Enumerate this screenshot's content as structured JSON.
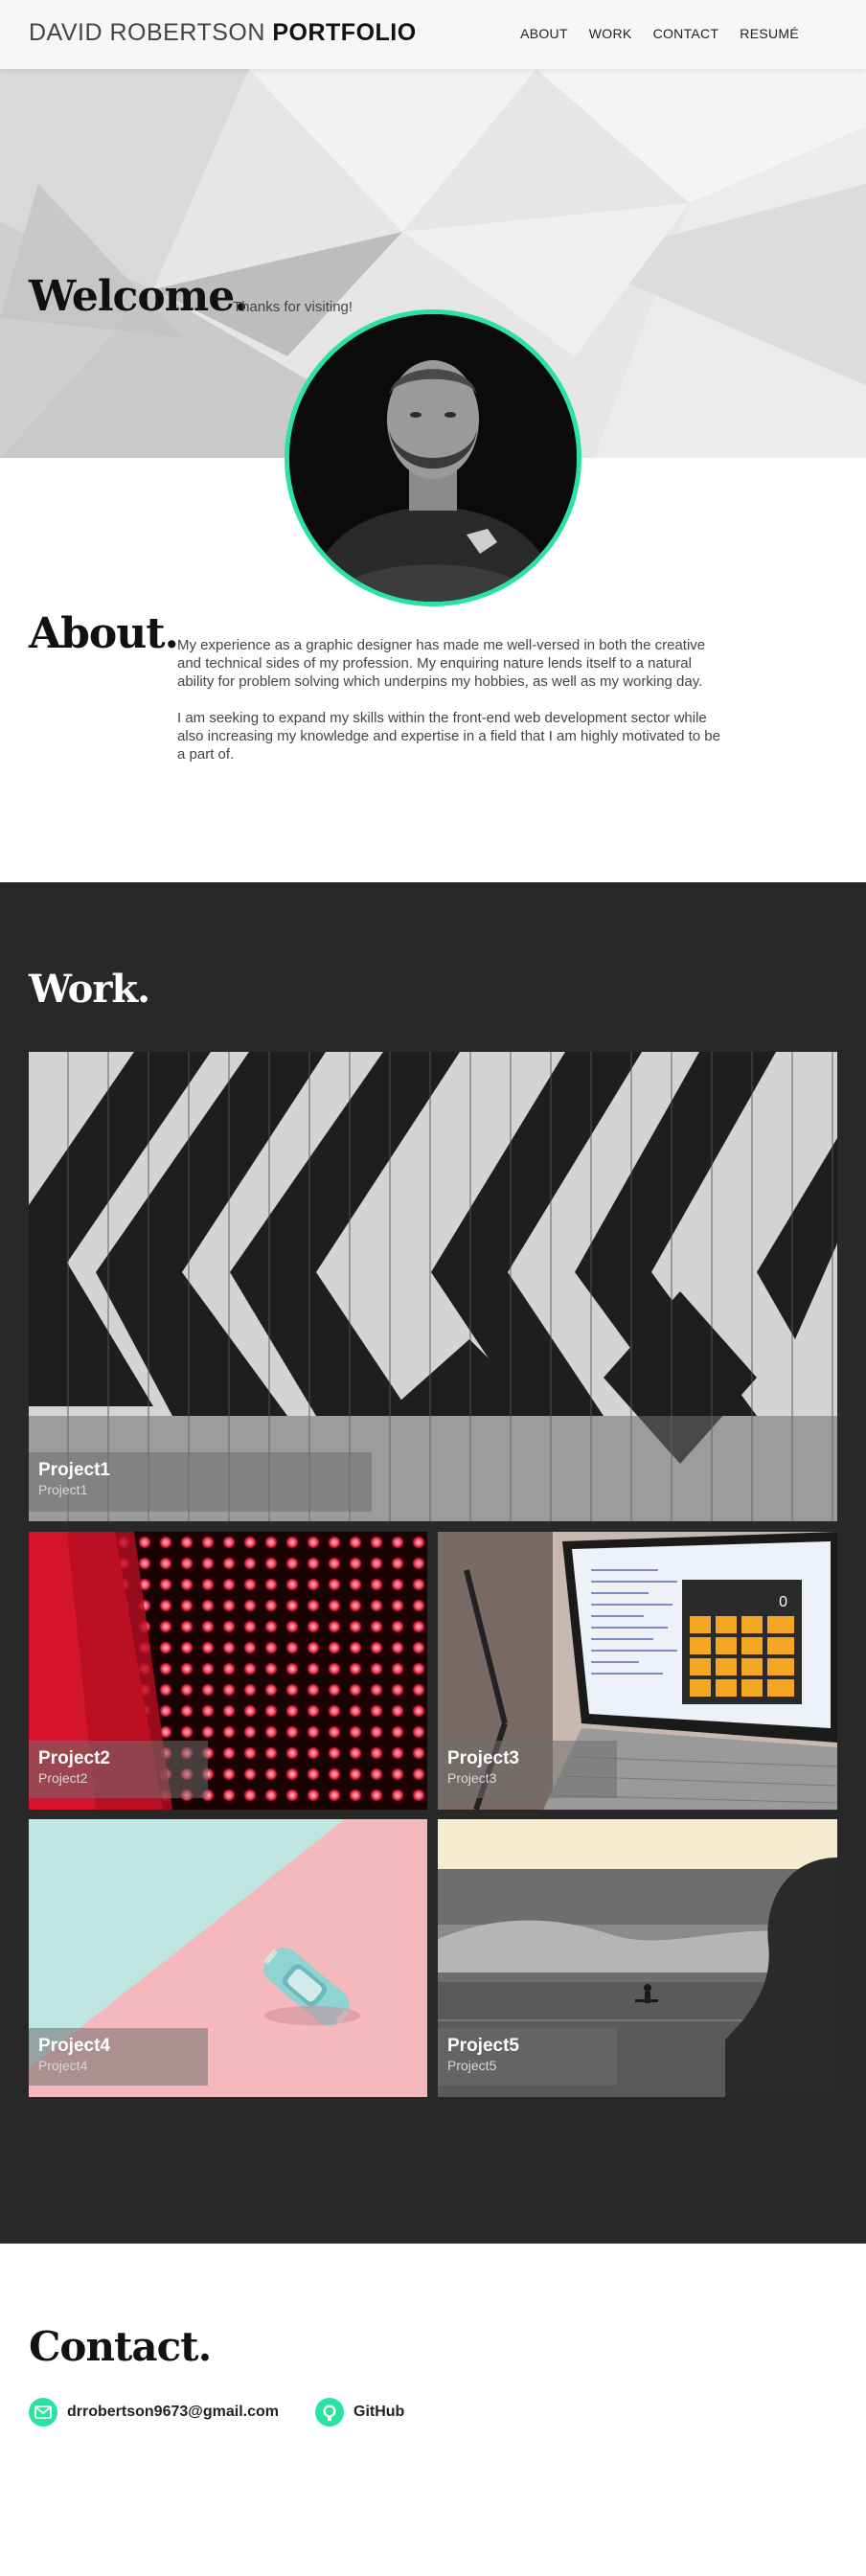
{
  "header": {
    "brand_light": "DAVID ROBERTSON",
    "brand_bold": "PORTFOLIO",
    "nav": [
      "ABOUT",
      "WORK",
      "CONTACT",
      "RESUMÉ"
    ]
  },
  "hero": {
    "title": "Welcome.",
    "tagline": "Thanks for visiting!"
  },
  "about": {
    "title": "About.",
    "paragraphs": [
      "My experience as a graphic designer has made me well-versed in both the creative and technical sides of my profession. My enquiring nature lends itself to a natural ability for problem solving which underpins my hobbies, as well as my working day.",
      "I am seeking to expand my skills within the front-end web development sector while also increasing my knowledge and expertise in a field that I am highly motivated to be a part of."
    ]
  },
  "work": {
    "title": "Work.",
    "projects": [
      {
        "title": "Project1",
        "subtitle": "Project1"
      },
      {
        "title": "Project2",
        "subtitle": "Project2"
      },
      {
        "title": "Project3",
        "subtitle": "Project3"
      },
      {
        "title": "Project4",
        "subtitle": "Project4"
      },
      {
        "title": "Project5",
        "subtitle": "Project5"
      }
    ],
    "calculator_display": "0"
  },
  "contact": {
    "title": "Contact.",
    "email": "drrobertson9673@gmail.com",
    "github": "GitHub"
  },
  "colors": {
    "accent": "#2be3a0",
    "work_bg": "#282828"
  },
  "icons": {
    "email": "mail-icon",
    "github": "github-icon"
  }
}
